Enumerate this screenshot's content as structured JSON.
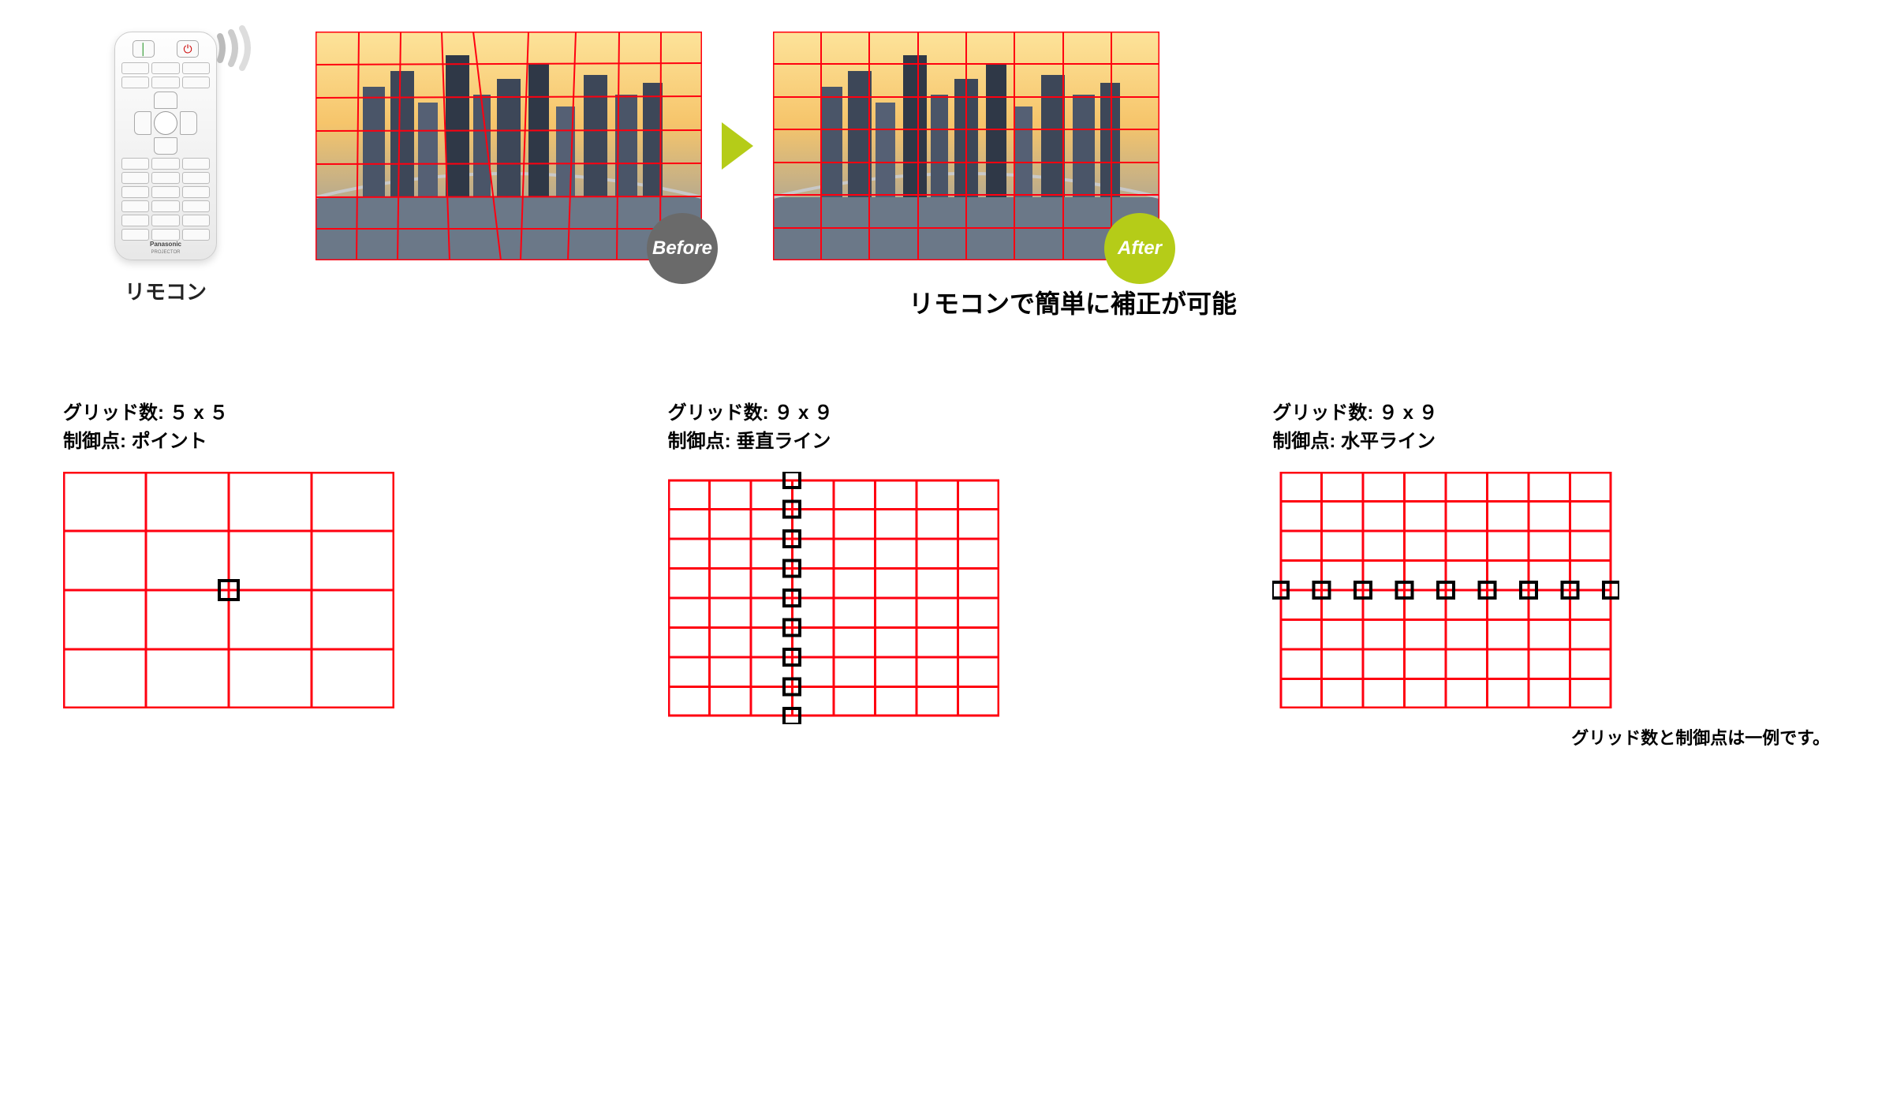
{
  "remote": {
    "label": "リモコン",
    "brand": "Panasonic",
    "brand_sub": "PROJECTOR"
  },
  "comparison": {
    "before_badge": "Before",
    "after_badge": "After",
    "caption": "リモコンで簡単に補正が可能"
  },
  "grids": {
    "label_grid_prefix": "グリッド数: ",
    "label_ctrl_prefix": "制御点: ",
    "items": [
      {
        "grid": "５ x ５",
        "control": "ポイント",
        "cols": 4,
        "rows": 4,
        "mode": "point"
      },
      {
        "grid": "９ x ９",
        "control": "垂直ライン",
        "cols": 8,
        "rows": 8,
        "mode": "vline"
      },
      {
        "grid": "９ x ９",
        "control": "水平ライン",
        "cols": 8,
        "rows": 8,
        "mode": "hline"
      }
    ],
    "note": "グリッド数と制御点は一例です。"
  }
}
